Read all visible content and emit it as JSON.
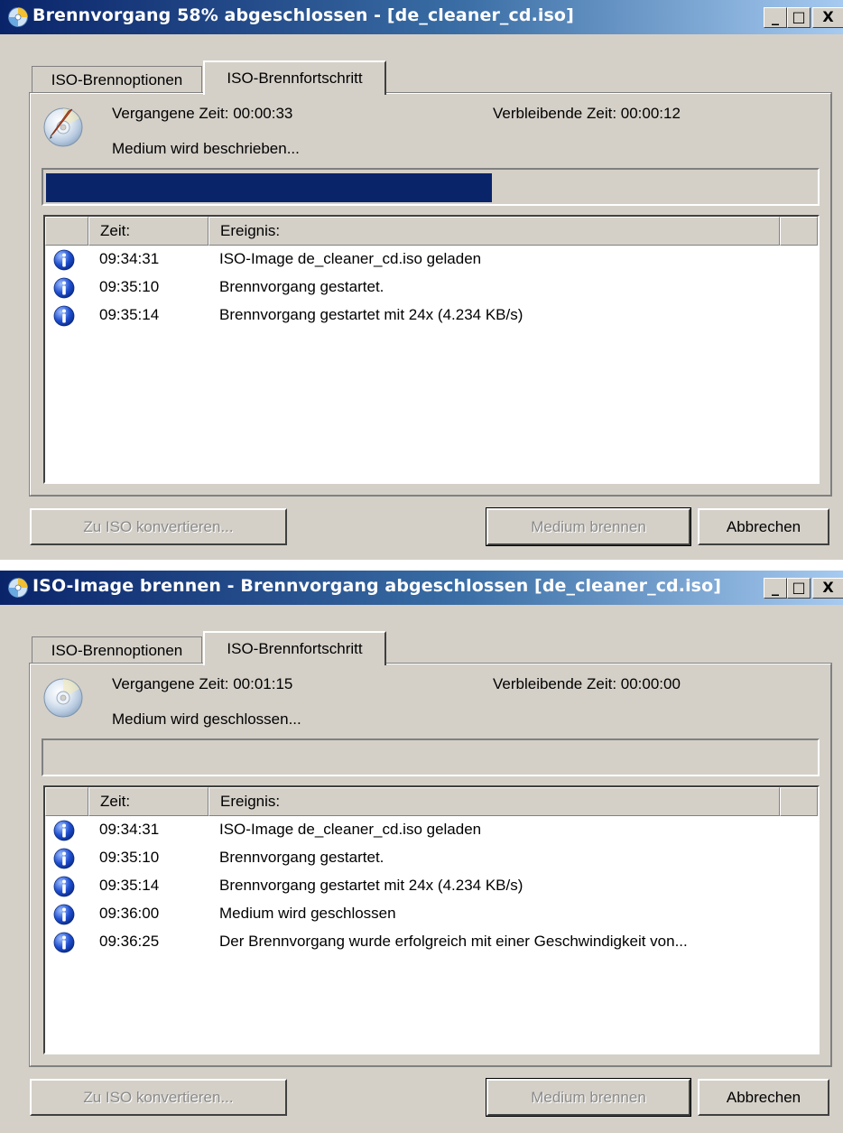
{
  "windows": [
    {
      "title": "Brennvorgang 58% abgeschlossen - [de_cleaner_cd.iso]",
      "titlebar_buttons": {
        "minimize": "_",
        "maximize": "□",
        "close": "X"
      },
      "tabs": [
        {
          "label": "ISO-Brennoptionen",
          "active": false
        },
        {
          "label": "ISO-Brennfortschritt",
          "active": true
        }
      ],
      "disc_icon": "disc-burning-icon",
      "elapsed": "Vergangene Zeit: 00:00:33",
      "remaining": "Verbleibende Zeit: 00:00:12",
      "status": "Medium wird beschrieben...",
      "progress_percent": 58,
      "log": {
        "columns": [
          "Zeit:",
          "Ereignis:"
        ],
        "rows": [
          {
            "icon": "info-icon",
            "time": "09:34:31",
            "event": "ISO-Image de_cleaner_cd.iso geladen"
          },
          {
            "icon": "info-icon",
            "time": "09:35:10",
            "event": "Brennvorgang gestartet."
          },
          {
            "icon": "info-icon",
            "time": "09:35:14",
            "event": "Brennvorgang gestartet mit 24x (4.234 KB/s)"
          }
        ]
      },
      "buttons": {
        "convert": {
          "label": "Zu ISO konvertieren...",
          "disabled": true
        },
        "burn": {
          "label": "Medium brennen",
          "disabled": true
        },
        "cancel": {
          "label": "Abbrechen",
          "disabled": false
        }
      }
    },
    {
      "title": "ISO-Image brennen - Brennvorgang abgeschlossen [de_cleaner_cd.iso]",
      "titlebar_buttons": {
        "minimize": "_",
        "maximize": "□",
        "close": "X"
      },
      "tabs": [
        {
          "label": "ISO-Brennoptionen",
          "active": false
        },
        {
          "label": "ISO-Brennfortschritt",
          "active": true
        }
      ],
      "disc_icon": "disc-icon",
      "elapsed": "Vergangene Zeit: 00:01:15",
      "remaining": "Verbleibende Zeit: 00:00:00",
      "status": "Medium wird geschlossen...",
      "progress_percent": 0,
      "log": {
        "columns": [
          "Zeit:",
          "Ereignis:"
        ],
        "rows": [
          {
            "icon": "info-icon",
            "time": "09:34:31",
            "event": "ISO-Image de_cleaner_cd.iso geladen"
          },
          {
            "icon": "info-icon",
            "time": "09:35:10",
            "event": "Brennvorgang gestartet."
          },
          {
            "icon": "info-icon",
            "time": "09:35:14",
            "event": "Brennvorgang gestartet mit 24x (4.234 KB/s)"
          },
          {
            "icon": "info-icon",
            "time": "09:36:00",
            "event": "Medium wird geschlossen"
          },
          {
            "icon": "info-icon",
            "time": "09:36:25",
            "event": "Der Brennvorgang wurde erfolgreich mit einer Geschwindigkeit von..."
          }
        ]
      },
      "buttons": {
        "convert": {
          "label": "Zu ISO konvertieren...",
          "disabled": true
        },
        "burn": {
          "label": "Medium brennen",
          "disabled": true
        },
        "cancel": {
          "label": "Abbrechen",
          "disabled": false
        }
      }
    }
  ],
  "colors": {
    "titlebar_start": "#0a246a",
    "titlebar_end": "#a6caf0",
    "progress_fill": "#0a246a",
    "face": "#d4d0c8"
  }
}
